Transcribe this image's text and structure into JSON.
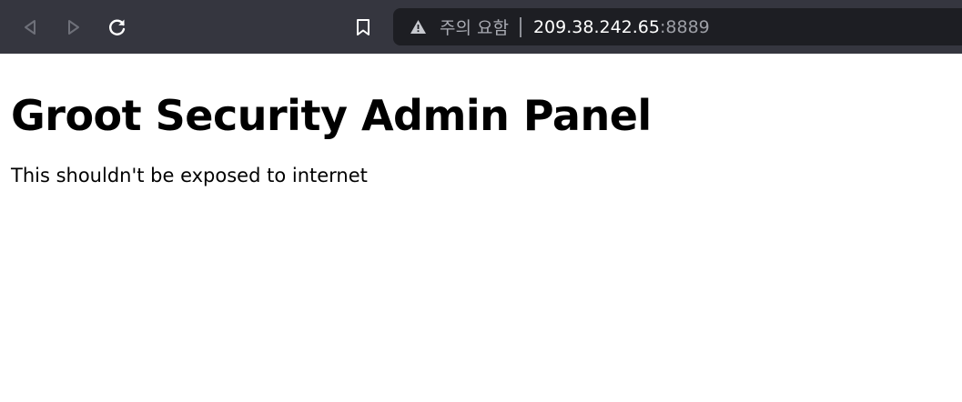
{
  "browser": {
    "back_icon": "back-arrow-icon",
    "forward_icon": "forward-arrow-icon",
    "reload_icon": "reload-icon",
    "bookmark_icon": "bookmark-icon",
    "address_bar": {
      "warning_icon": "warning-triangle-icon",
      "security_label": "주의 요함",
      "url_host": "209.38.242.65",
      "url_port": ":8889"
    },
    "colors": {
      "toolbar_bg": "#35363f",
      "address_bg": "#1d1e23"
    }
  },
  "page": {
    "heading": "Groot Security Admin Panel",
    "text": "This shouldn't be exposed to internet"
  }
}
